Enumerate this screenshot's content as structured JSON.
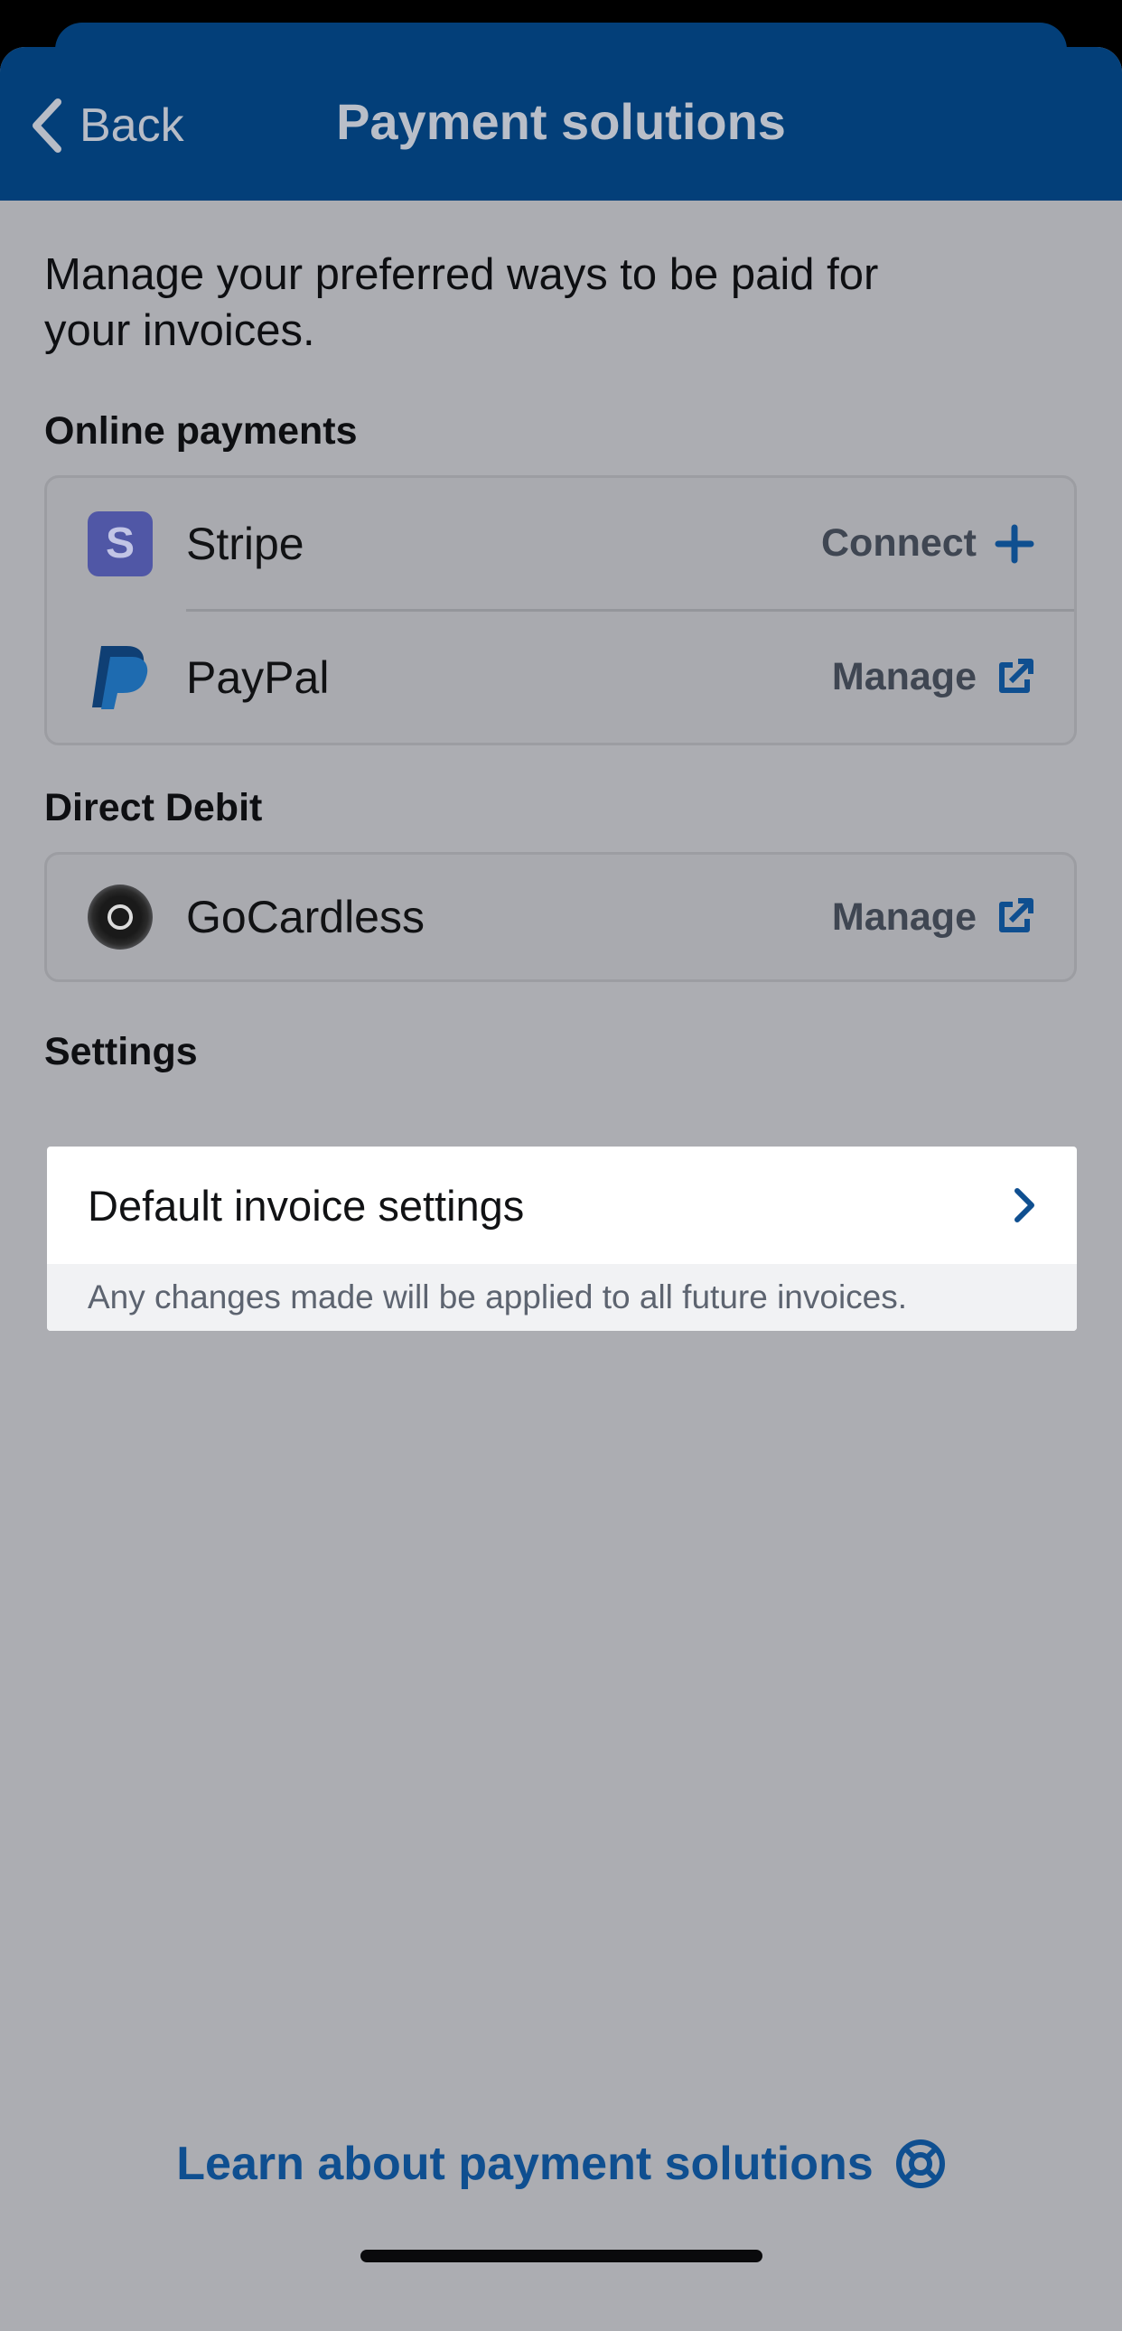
{
  "header": {
    "back_label": "Back",
    "title": "Payment solutions"
  },
  "intro_text": "Manage your preferred ways to be paid for your invoices.",
  "online_payments": {
    "title": "Online payments",
    "items": [
      {
        "name": "Stripe",
        "logo_letter": "S",
        "action": "Connect",
        "action_icon": "plus-icon"
      },
      {
        "name": "PayPal",
        "action": "Manage",
        "action_icon": "external-link-icon"
      }
    ]
  },
  "direct_debit": {
    "title": "Direct Debit",
    "items": [
      {
        "name": "GoCardless",
        "action": "Manage",
        "action_icon": "external-link-icon"
      }
    ]
  },
  "settings": {
    "title": "Settings",
    "default_invoice_label": "Default invoice settings",
    "note": "Any changes made will be applied to all future invoices."
  },
  "footer": {
    "learn_link": "Learn about payment solutions",
    "learn_icon": "lifebuoy-icon"
  },
  "colors": {
    "header_bg": "#033f79",
    "overlay_bg": "#acadb2",
    "accent_blue": "#0f4f90",
    "stripe_purple": "#5057a6"
  }
}
